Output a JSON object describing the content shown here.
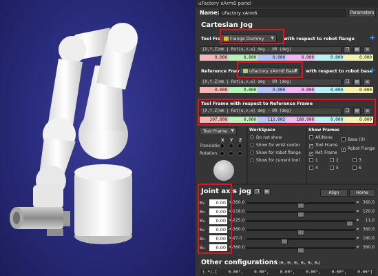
{
  "window_title": "uFactory xArm6 panel",
  "name_label": "Name:",
  "name_value": "uFactory xArm6",
  "parameters_button": "Parameters",
  "cartesian_title": "Cartesian Jog",
  "tool_frame": {
    "label": "Tool Frame",
    "selected": "Flange Dummy",
    "suffix": "with respect to robot flange",
    "header": "[X,Y,Z]mm | Rot[u,v,w] deg - UR (deg)",
    "values": [
      "0.000",
      "0.000",
      "0.000",
      "0.000",
      "0.000",
      "0.000"
    ]
  },
  "reference_frame": {
    "label": "Reference Frame",
    "selected": "uFactory xArm6 Base",
    "suffix": "with respect to robot base",
    "header": "[X,Y,Z]mm | Rot[u,v,w] deg - UR (deg)",
    "values": [
      "0.000",
      "0.000",
      "0.000",
      "0.000",
      "0.000",
      "0.000"
    ]
  },
  "tool_wrt_ref": {
    "title": "Tool Frame with respect to Reference Frame",
    "header": "[X,Y,Z]mm | Rot[u,v,w] deg - UR (deg)",
    "values": [
      "207.000",
      "0.000",
      "112.002",
      "180.000",
      "0.000",
      "0.000"
    ]
  },
  "jog": {
    "frame_select": "Tool Frame",
    "axes": [
      "X",
      "Y",
      "Z"
    ],
    "translation_label": "Translation",
    "rotation_label": "Rotation"
  },
  "workspace": {
    "title": "WorkSpace",
    "options": [
      "Do not show",
      "Show for wrist center",
      "Show for robot flange",
      "Show for current tool"
    ],
    "selected_index": 0
  },
  "show_frames": {
    "title": "Show Frames",
    "items": [
      {
        "label": "All/None",
        "checked": false
      },
      {
        "label": "Base (0)",
        "checked": false
      },
      {
        "label": "Tool Frame",
        "checked": true
      },
      {
        "label": "Robot Flange",
        "checked": true
      },
      {
        "label": "Ref. Frame",
        "checked": true
      },
      {
        "label": "1",
        "checked": false
      },
      {
        "label": "2",
        "checked": false
      },
      {
        "label": "3",
        "checked": false
      },
      {
        "label": "4",
        "checked": false
      },
      {
        "label": "5",
        "checked": false
      },
      {
        "label": "6",
        "checked": false
      }
    ]
  },
  "joint_title": "Joint axis jog",
  "align_button": "Align",
  "home_button": "Home",
  "joints": [
    {
      "label": "θ₁:",
      "value": "0.00",
      "min": "-360.0",
      "max": "360.0",
      "position": 0.5
    },
    {
      "label": "θ₂:",
      "value": "0.00",
      "min": "-118.0",
      "max": "120.0",
      "position": 0.5
    },
    {
      "label": "θ₃:",
      "value": "0.00",
      "min": "-225.0",
      "max": "11.0",
      "position": 0.95
    },
    {
      "label": "θ₄:",
      "value": "0.00",
      "min": "-360.0",
      "max": "360.0",
      "position": 0.5
    },
    {
      "label": "θ₅:",
      "value": "0.00",
      "min": "-97.0",
      "max": "180.0",
      "position": 0.35
    },
    {
      "label": "θ₆:",
      "value": "0.00",
      "min": "-360.0",
      "max": "360.0",
      "position": 0.5
    }
  ],
  "other_config_title": "Other configurations",
  "other_config_sub": "(θ₁, θ₂, θ₃, θ₄, θ₅, θ₆)",
  "other_config_row": [
    "( *)-[",
    "0.00°,",
    "0.00°,",
    "0.00°,",
    "0.00°,",
    "0.00°,",
    "0.00°]"
  ]
}
